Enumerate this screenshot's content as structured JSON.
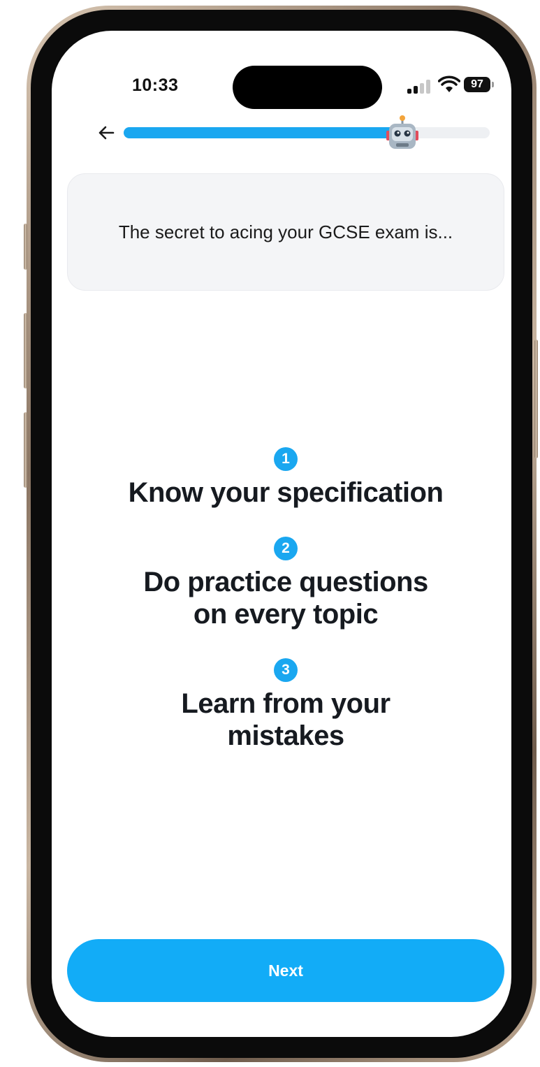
{
  "status_bar": {
    "time": "10:33",
    "battery": "97"
  },
  "progress": {
    "value": 0.76
  },
  "question": "The secret to acing your GCSE exam is...",
  "tips": [
    {
      "number": "1",
      "text": "Know your specification"
    },
    {
      "number": "2",
      "text": "Do practice questions on every topic"
    },
    {
      "number": "3",
      "text": "Learn from your mistakes"
    }
  ],
  "actions": {
    "next_label": "Next"
  },
  "colors": {
    "accent": "#12acf7",
    "text": "#161a20",
    "card": "#f4f5f7"
  },
  "icons": {
    "back": "arrow-left-icon",
    "mascot": "robot-icon"
  }
}
